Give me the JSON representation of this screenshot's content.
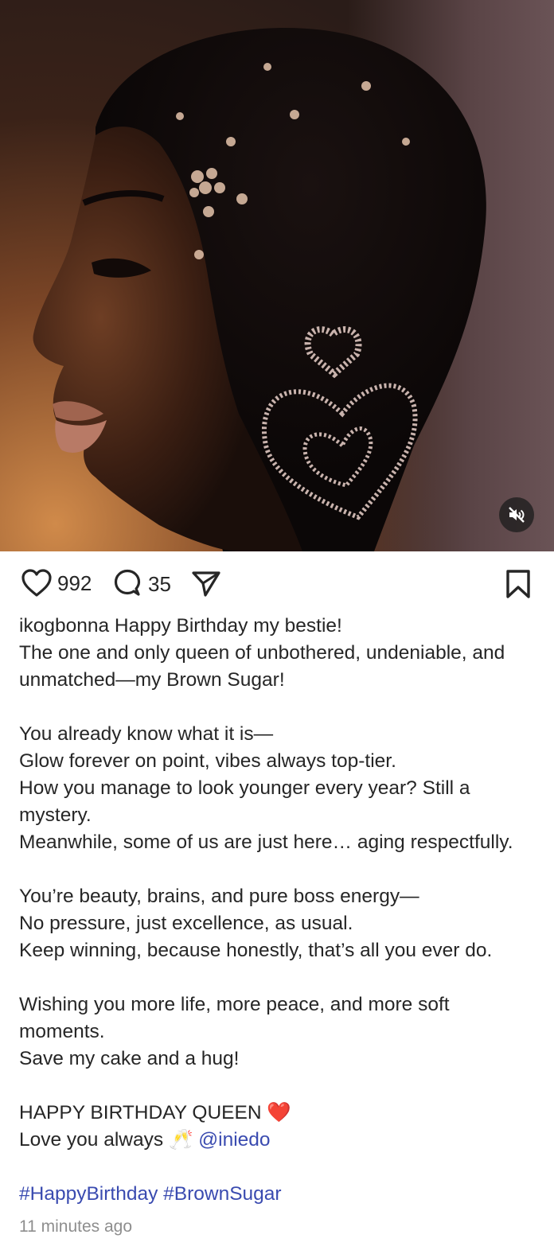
{
  "media": {
    "alt": "Profile portrait of a woman with slicked hair adorned with crystals and heart-shaped rhinestone earring",
    "mute_icon": "speaker-muted-icon"
  },
  "actions": {
    "like_icon": "heart-icon",
    "likes": "992",
    "comment_icon": "comment-bubble-icon",
    "comments": "35",
    "share_icon": "paper-plane-icon",
    "save_icon": "bookmark-icon"
  },
  "caption": {
    "username": "ikogbonna",
    "first": "Happy Birthday my bestie!",
    "lines_a": [
      "The one and only queen of unbothered, undeniable, and",
      "unmatched—my Brown Sugar!"
    ],
    "lines_b": [
      "You already know what it is—",
      "Glow forever on point, vibes always top-tier.",
      "How you manage to look younger every year? Still a",
      "mystery.",
      "Meanwhile, some of us are just here… aging respectfully."
    ],
    "lines_c": [
      "You’re beauty, brains, and pure boss energy—",
      "No pressure, just excellence, as usual.",
      "Keep winning, because honestly, that’s all you ever do."
    ],
    "lines_d": [
      "Wishing you more life, more peace, and more soft",
      "moments.",
      "Save my cake and a hug!"
    ],
    "closing_1": "HAPPY BIRTHDAY QUEEN",
    "heart_emoji": "❤️",
    "closing_2": "Love you always",
    "cheers_emoji": "🥂",
    "mention": "@iniedo",
    "hashtag_1": "#HappyBirthday",
    "hashtag_2": "#BrownSugar"
  },
  "timestamp": "11 minutes ago"
}
